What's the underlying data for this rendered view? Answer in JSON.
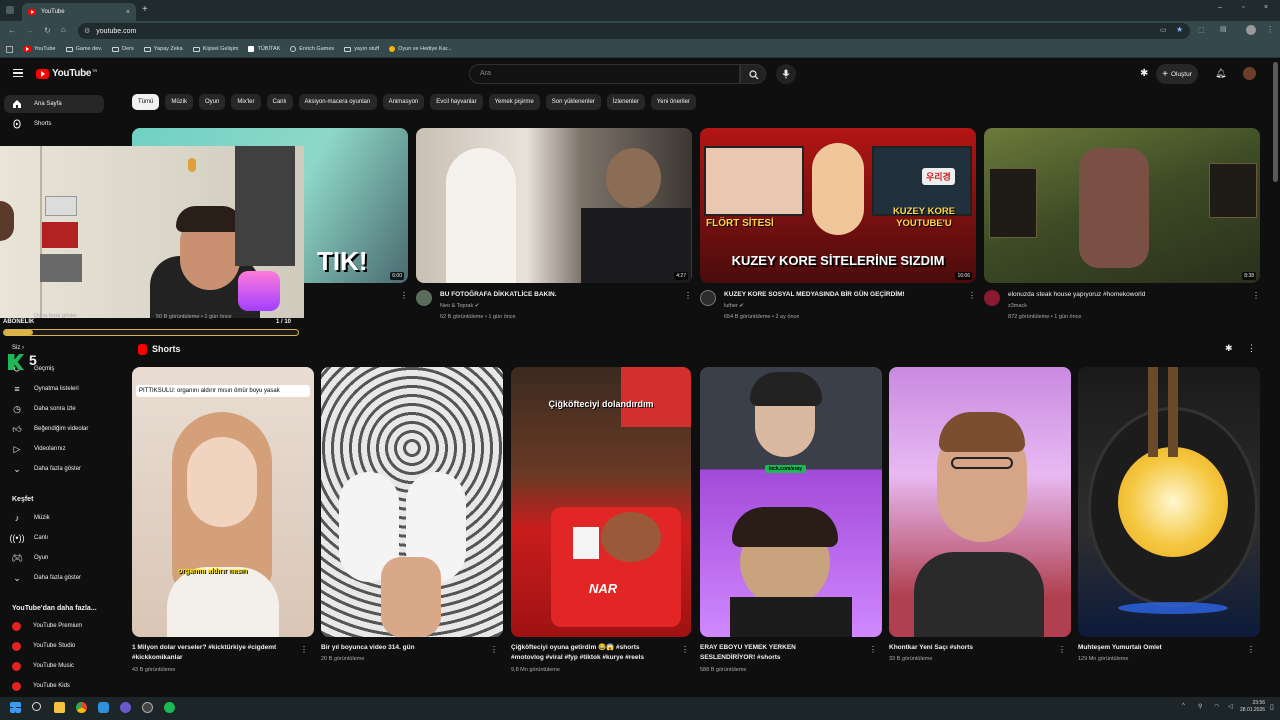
{
  "browser": {
    "tab_title": "YouTube",
    "url": "youtube.com",
    "bookmarks": [
      "YouTube",
      "Game dev.",
      "Ders",
      "Yapay Zeka",
      "Kişisel Gelişim",
      "TÜBİTAK",
      "Enrich Games",
      "yayın stuff",
      "Oyun ve Hediye Kar..."
    ]
  },
  "header": {
    "logo": "YouTube",
    "logo_sup": "TR",
    "search_placeholder": "Ara",
    "create_label": "Oluştur"
  },
  "chips": [
    "Tümü",
    "Müzik",
    "Oyun",
    "Mix'ler",
    "Canlı",
    "Aksiyon-macera oyunları",
    "Animasyon",
    "Evcil hayvanlar",
    "Yemek pişirme",
    "Son yüklenenler",
    "İzlenenler",
    "Yeni öneriler"
  ],
  "sidebar": {
    "top": [
      {
        "label": "Ana Sayfa",
        "icon": "home-icon"
      },
      {
        "label": "Shorts",
        "icon": "shorts-icon"
      }
    ],
    "you_label": "Siz",
    "you_items": [
      {
        "label": "Geçmiş",
        "icon": "history-icon"
      },
      {
        "label": "Oynatma listeleri",
        "icon": "playlist-icon"
      },
      {
        "label": "Daha sonra izle",
        "icon": "clock-icon"
      },
      {
        "label": "Beğendiğim videolar",
        "icon": "thumbs-up-icon"
      },
      {
        "label": "Videolarınız",
        "icon": "video-icon"
      },
      {
        "label": "Daha fazla göster",
        "icon": "chevron-down-icon"
      }
    ],
    "explore_label": "Keşfet",
    "explore_items": [
      {
        "label": "Müzik",
        "icon": "music-icon"
      },
      {
        "label": "Canlı",
        "icon": "live-icon"
      },
      {
        "label": "Oyun",
        "icon": "gaming-icon"
      },
      {
        "label": "Daha fazla göster",
        "icon": "chevron-down-icon"
      }
    ],
    "more_label": "YouTube'dan daha fazla...",
    "more_items": [
      {
        "label": "YouTube Premium"
      },
      {
        "label": "YouTube Studio"
      },
      {
        "label": "YouTube Music"
      },
      {
        "label": "YouTube Kids"
      }
    ]
  },
  "overlay": {
    "subs_label": "ABONELİK",
    "counter": "1 / 10",
    "sub_count": "5",
    "partial_meta": "50 B görüntüleme • 1 gün önce",
    "partial_text": "Daha fazla göster",
    "thumb_text": "TIK!"
  },
  "videos": [
    {
      "duration": "6:00"
    },
    {
      "title": "BU FOTOĞRAFA DİKKATLİCE BAKIN.",
      "channel": "Neo & Toprak",
      "meta": "62 B görüntüleme • 1 gün önce",
      "duration": "4:27"
    },
    {
      "title": "KUZEY KORE SOSYAL MEDYASINDA BİR GÜN GEÇİRDİM!",
      "channel": "luther",
      "meta": "654 B görüntüleme • 2 ay önce",
      "duration": "16:06",
      "thumb_texts": [
        "FLÖRT SİTESİ",
        "KUZEY KORE YOUTUBE'U",
        "KUZEY KORE SİTELERİNE SIZDIM",
        "우리경"
      ]
    },
    {
      "title": "elonuzda steak house yapıyoruz #homekoworld",
      "channel": "z3mack",
      "meta": "872 görüntüleme • 1 gün önce",
      "duration": "8:38"
    }
  ],
  "shorts_section": {
    "title": "Shorts",
    "items": [
      {
        "title": "1 Milyon dolar verseler?  #kicktürkiye #cigdemt #kickkomikanlar",
        "meta": "43 B görüntüleme",
        "overlay_top": "PITTIKSULU: organını aldırır mısın ömür boyu yasak",
        "overlay_bottom": "organını aldırır mısın"
      },
      {
        "title": "Bir yıl boyunca video 314. gün",
        "meta": "20 B görüntüleme"
      },
      {
        "title": "Çiğköfteciyi oyuna getirdim 😂😱 #shorts",
        "title2": "#motovlog #viral #fyp #tiktok #kurye #reels",
        "meta": "9,8 Mn görüntüleme",
        "overlay_top": "Çiğköfteciyi dolandırdım",
        "overlay_bottom": "NAR"
      },
      {
        "title": "ERAY EBOYU YEMEK YERKEN",
        "title2": "SESLENDİRİYOR! #shorts",
        "meta": "588 B görüntüleme",
        "overlay_top": "kick.com/eray"
      },
      {
        "title": "Khontkar Yeni Saçı #shorts",
        "meta": "33 B görüntüleme"
      },
      {
        "title": "Muhteşem Yumurtalı Omlet",
        "meta": "129 Mn görüntüleme"
      }
    ]
  },
  "taskbar": {
    "time": "23:56",
    "date": "28.01.2026"
  },
  "colors": {
    "accent": "#ff0000",
    "bg": "#0f0f0f",
    "chip": "#272727"
  }
}
